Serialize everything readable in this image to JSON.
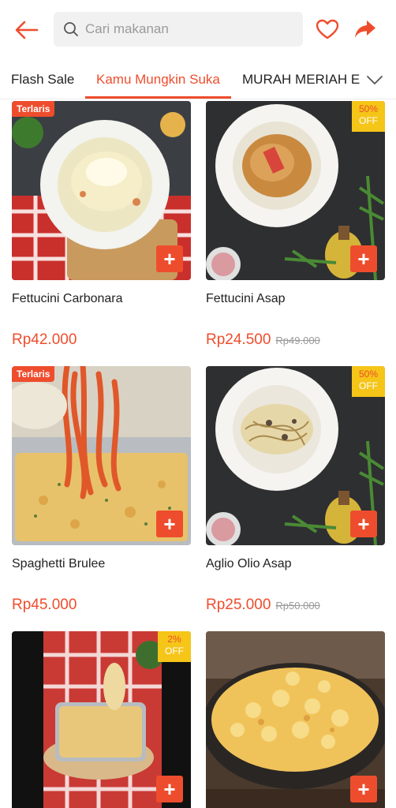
{
  "header": {
    "search_placeholder": "Cari makanan",
    "back_icon": "arrow-left-icon",
    "favorite_icon": "heart-icon",
    "share_icon": "share-icon"
  },
  "tabs": [
    {
      "label": "Flash Sale"
    },
    {
      "label": "Kamu Mungkin Suka"
    },
    {
      "label": "MURAH MERIAH E"
    }
  ],
  "colors": {
    "accent": "#ee4d2d",
    "discount_badge": "#f5c518"
  },
  "products": [
    {
      "name": "Fettucini Carbonara",
      "price": "Rp42.000",
      "old_price": "",
      "tag": "Terlaris",
      "discount": "",
      "off_label": ""
    },
    {
      "name": "Fettucini Asap",
      "price": "Rp24.500",
      "old_price": "Rp49.000",
      "tag": "",
      "discount": "50%",
      "off_label": "OFF"
    },
    {
      "name": "Spaghetti Brulee",
      "price": "Rp45.000",
      "old_price": "",
      "tag": "Terlaris",
      "discount": "",
      "off_label": ""
    },
    {
      "name": "Aglio Olio Asap",
      "price": "Rp25.000",
      "old_price": "Rp50.000",
      "tag": "",
      "discount": "50%",
      "off_label": "OFF"
    },
    {
      "name": "",
      "price": "",
      "old_price": "",
      "tag": "",
      "discount": "2%",
      "off_label": "OFF"
    },
    {
      "name": "",
      "price": "",
      "old_price": "",
      "tag": "",
      "discount": "",
      "off_label": ""
    }
  ],
  "add_label": "+"
}
